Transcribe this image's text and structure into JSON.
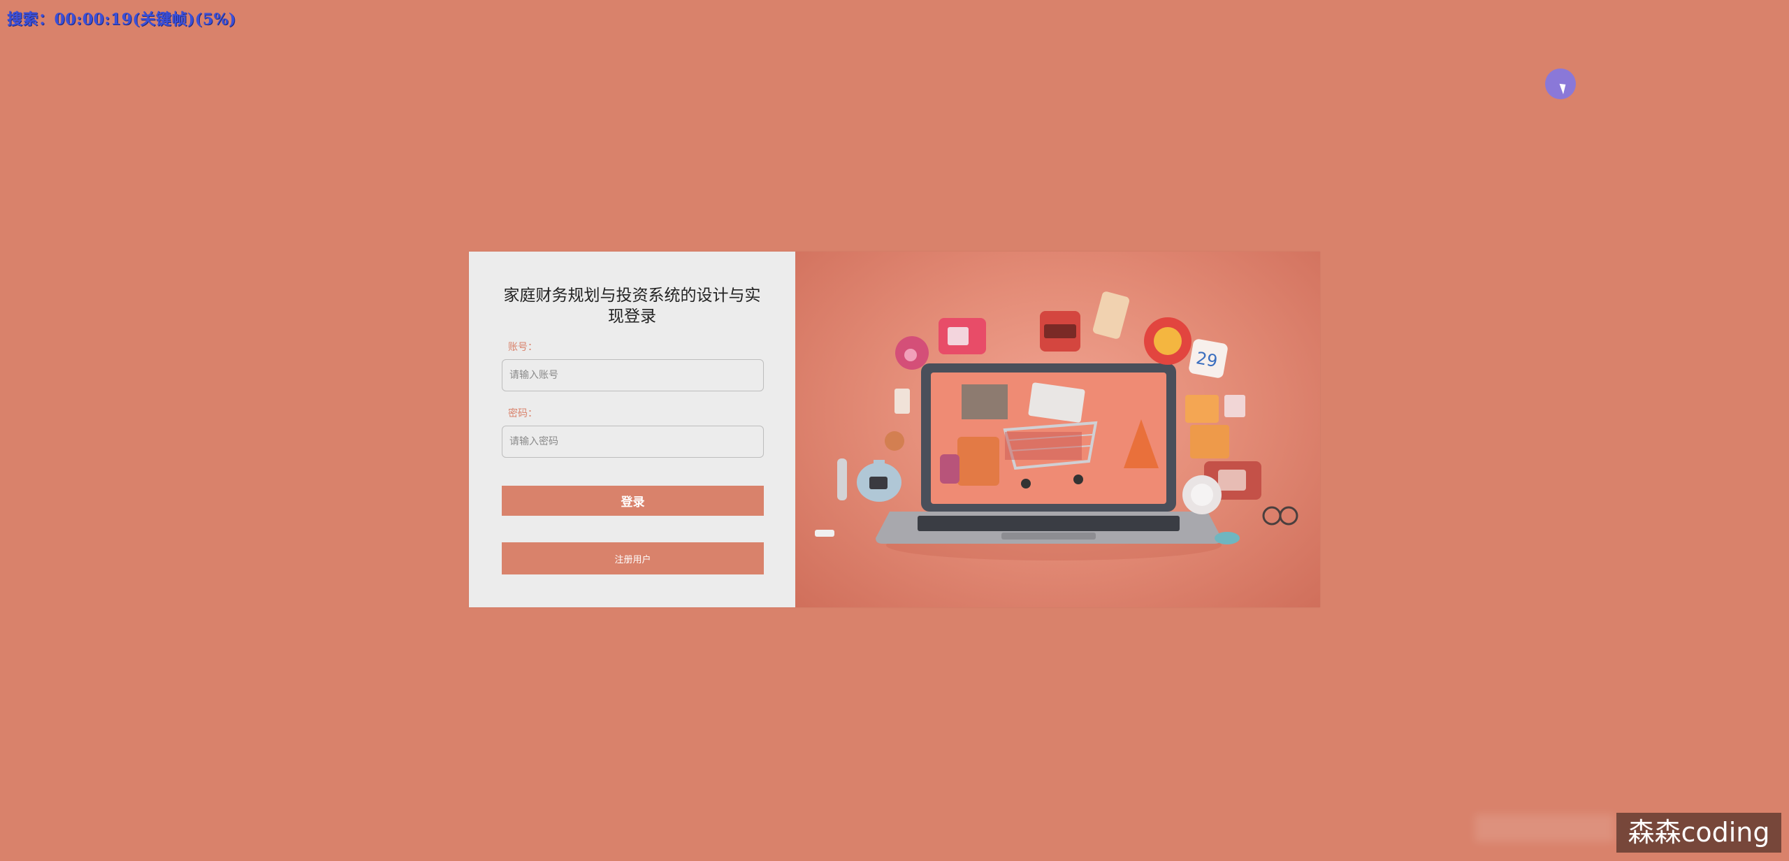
{
  "overlay": {
    "status_text": "搜索：00:00:19(关键帧)(5%)"
  },
  "login": {
    "title": "家庭财务规划与投资系统的设计与实现登录",
    "account_label": "账号：",
    "account_placeholder": "请输入账号",
    "password_label": "密码：",
    "password_placeholder": "请输入密码",
    "login_button": "登录",
    "register_button": "注册用户"
  },
  "watermark": {
    "text": "森森coding"
  },
  "colors": {
    "background": "#d9826b",
    "accent": "#d9826b",
    "panel": "#ececec"
  },
  "icons": {
    "cursor": "mouse-cursor-icon",
    "illustration": "shopping-laptop-illustration"
  }
}
